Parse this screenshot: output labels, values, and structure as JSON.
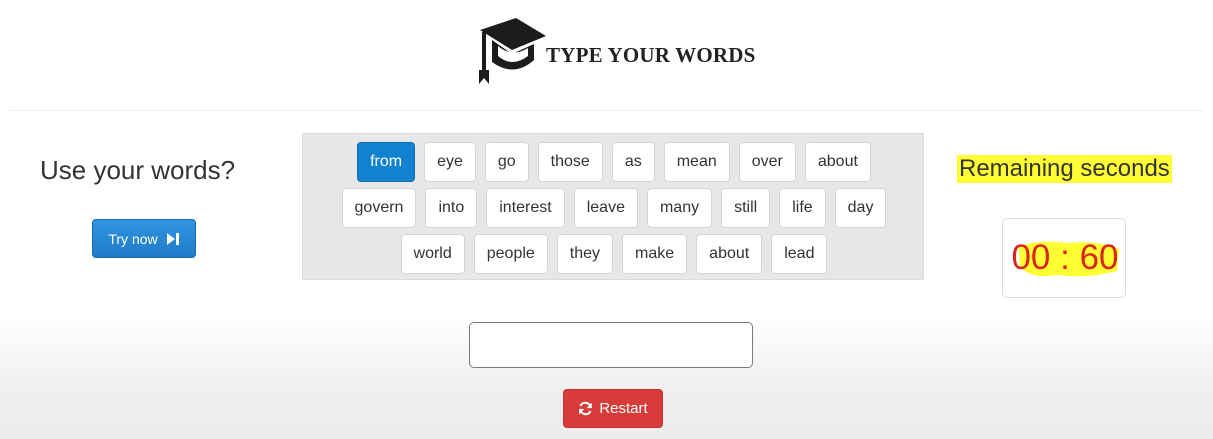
{
  "brand": {
    "name": "TYPE YOUR WORDS",
    "icon": "graduation-cap-icon"
  },
  "left": {
    "title": "Use your words?",
    "try_button": "Try now",
    "try_icon": "step-forward-icon"
  },
  "words": {
    "rows": [
      [
        "from",
        "eye",
        "go",
        "those",
        "as",
        "mean",
        "over",
        "about"
      ],
      [
        "govern",
        "into",
        "interest",
        "leave",
        "many",
        "still",
        "life",
        "day"
      ],
      [
        "world",
        "people",
        "they",
        "make",
        "about",
        "lead"
      ]
    ],
    "active": "from"
  },
  "right": {
    "title": "Remaining seconds",
    "timer": "00 : 60"
  },
  "input": {
    "value": "",
    "placeholder": ""
  },
  "restart": {
    "label": "Restart",
    "icon": "refresh-icon"
  },
  "colors": {
    "accent_blue": "#1281d0",
    "danger_red": "#d73c3a",
    "highlight_yellow": "#ffff33",
    "timer_red": "#d9261c"
  }
}
